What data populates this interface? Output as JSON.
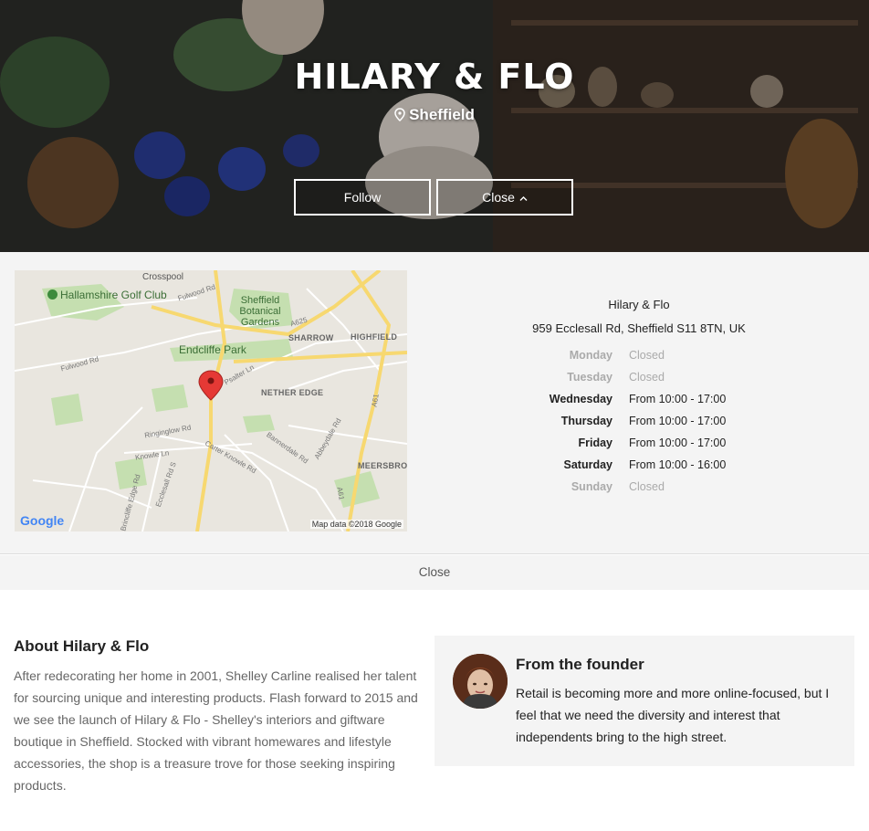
{
  "hero": {
    "title": "HILARY & FLO",
    "location": "Sheffield",
    "follow_label": "Follow",
    "close_label": "Close"
  },
  "map": {
    "labels": {
      "crosspool": "Crosspool",
      "golf": "Hallamshire Golf Club",
      "gardens": "Sheffield Botanical Gardens",
      "endcliffe": "Endcliffe Park",
      "sharrow": "SHARROW",
      "highfield": "HIGHFIELD",
      "nether_edge": "NETHER EDGE",
      "meersbrook": "MEERSBROO",
      "fulwood_rd_1": "Fulwood Rd",
      "fulwood_rd_2": "Fulwood Rd",
      "a625": "A625",
      "a61_1": "A61",
      "a61_2": "A61",
      "psalter": "Psalter Ln",
      "ringinglow": "Ringinglow Rd",
      "knowle": "Knowle Ln",
      "carter_knowle": "Carter Knowle Rd",
      "bannerdale": "Bannerdale Rd",
      "abbeydale": "Abbeydale Rd",
      "ecclesall": "Ecclesall Rd S",
      "brincliffe": "Brincliffe Edge Rd"
    },
    "google": "Google",
    "attribution": "Map data ©2018 Google"
  },
  "business": {
    "name": "Hilary & Flo",
    "address": "959 Ecclesall Rd, Sheffield S11 8TN, UK",
    "hours": [
      {
        "day": "Monday",
        "time": "Closed"
      },
      {
        "day": "Tuesday",
        "time": "Closed"
      },
      {
        "day": "Wednesday",
        "time": "From 10:00 - 17:00"
      },
      {
        "day": "Thursday",
        "time": "From 10:00 - 17:00"
      },
      {
        "day": "Friday",
        "time": "From 10:00 - 17:00"
      },
      {
        "day": "Saturday",
        "time": "From 10:00 - 16:00"
      },
      {
        "day": "Sunday",
        "time": "Closed"
      }
    ]
  },
  "close_bar": "Close",
  "about": {
    "title": "About Hilary & Flo",
    "text": "After redecorating her home in 2001, Shelley Carline realised her talent for sourcing unique and interesting products. Flash forward to 2015 and we see the launch of Hilary & Flo - Shelley's interiors and giftware boutique in Sheffield. Stocked with vibrant homewares and lifestyle accessories, the shop is a treasure trove for those seeking inspiring products."
  },
  "founder": {
    "title": "From the founder",
    "quote": "Retail is becoming more and more online-focused, but I feel that we need the diversity and interest that independents bring to the high street."
  },
  "colors": {
    "panel_bg": "#f4f4f4",
    "map_pin": "#e53935",
    "muted_text": "#aaaaaa"
  }
}
